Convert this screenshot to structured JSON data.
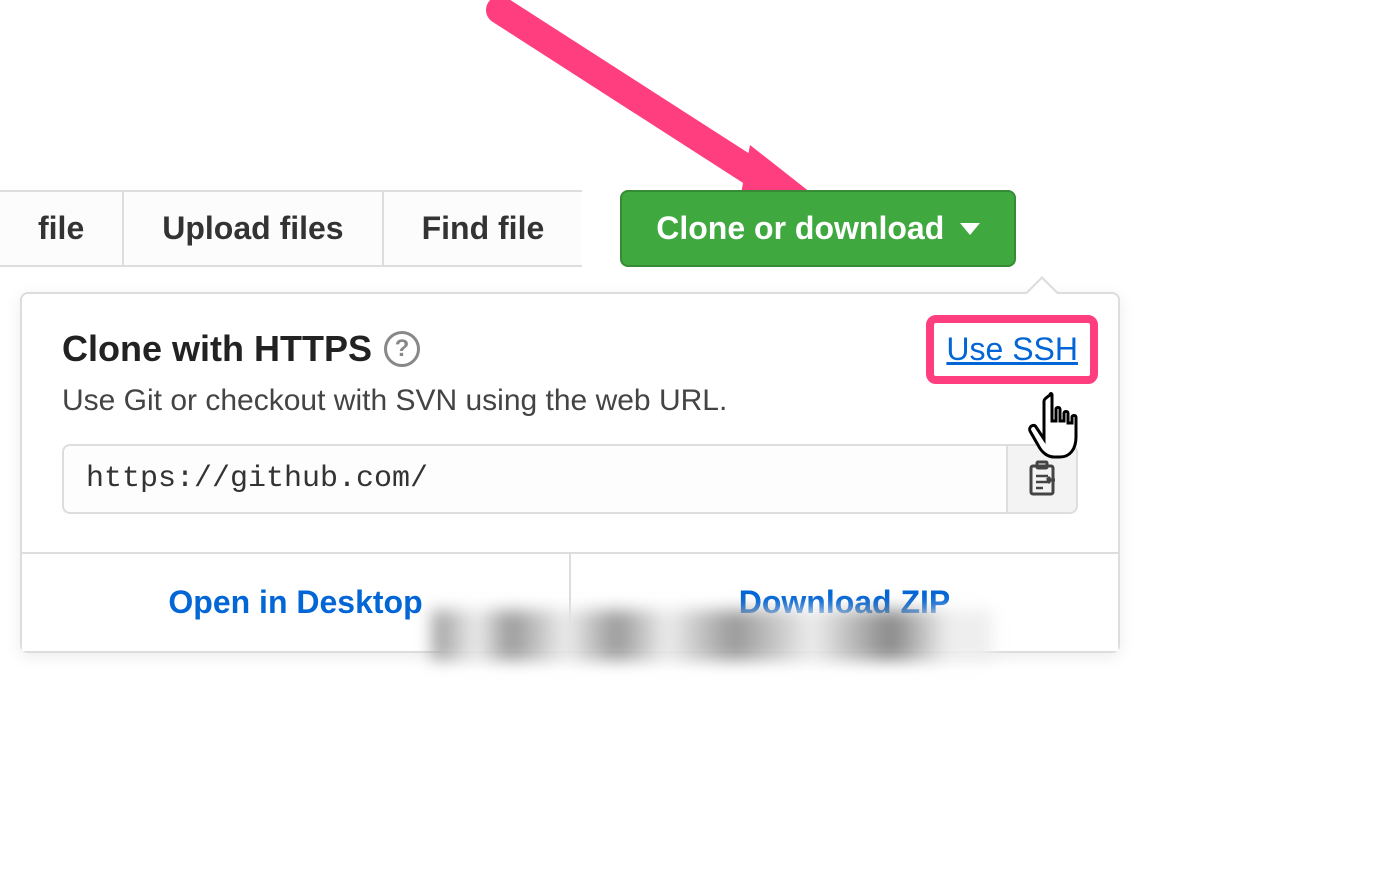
{
  "toolbar": {
    "new_file_label": "file",
    "upload_files_label": "Upload files",
    "find_file_label": "Find file",
    "clone_download_label": "Clone or download"
  },
  "dropdown": {
    "title": "Clone with HTTPS",
    "use_ssh_label": "Use SSH",
    "description": "Use Git or checkout with SVN using the web URL.",
    "url_value": "https://github.com/",
    "open_desktop_label": "Open in Desktop",
    "download_zip_label": "Download ZIP"
  }
}
